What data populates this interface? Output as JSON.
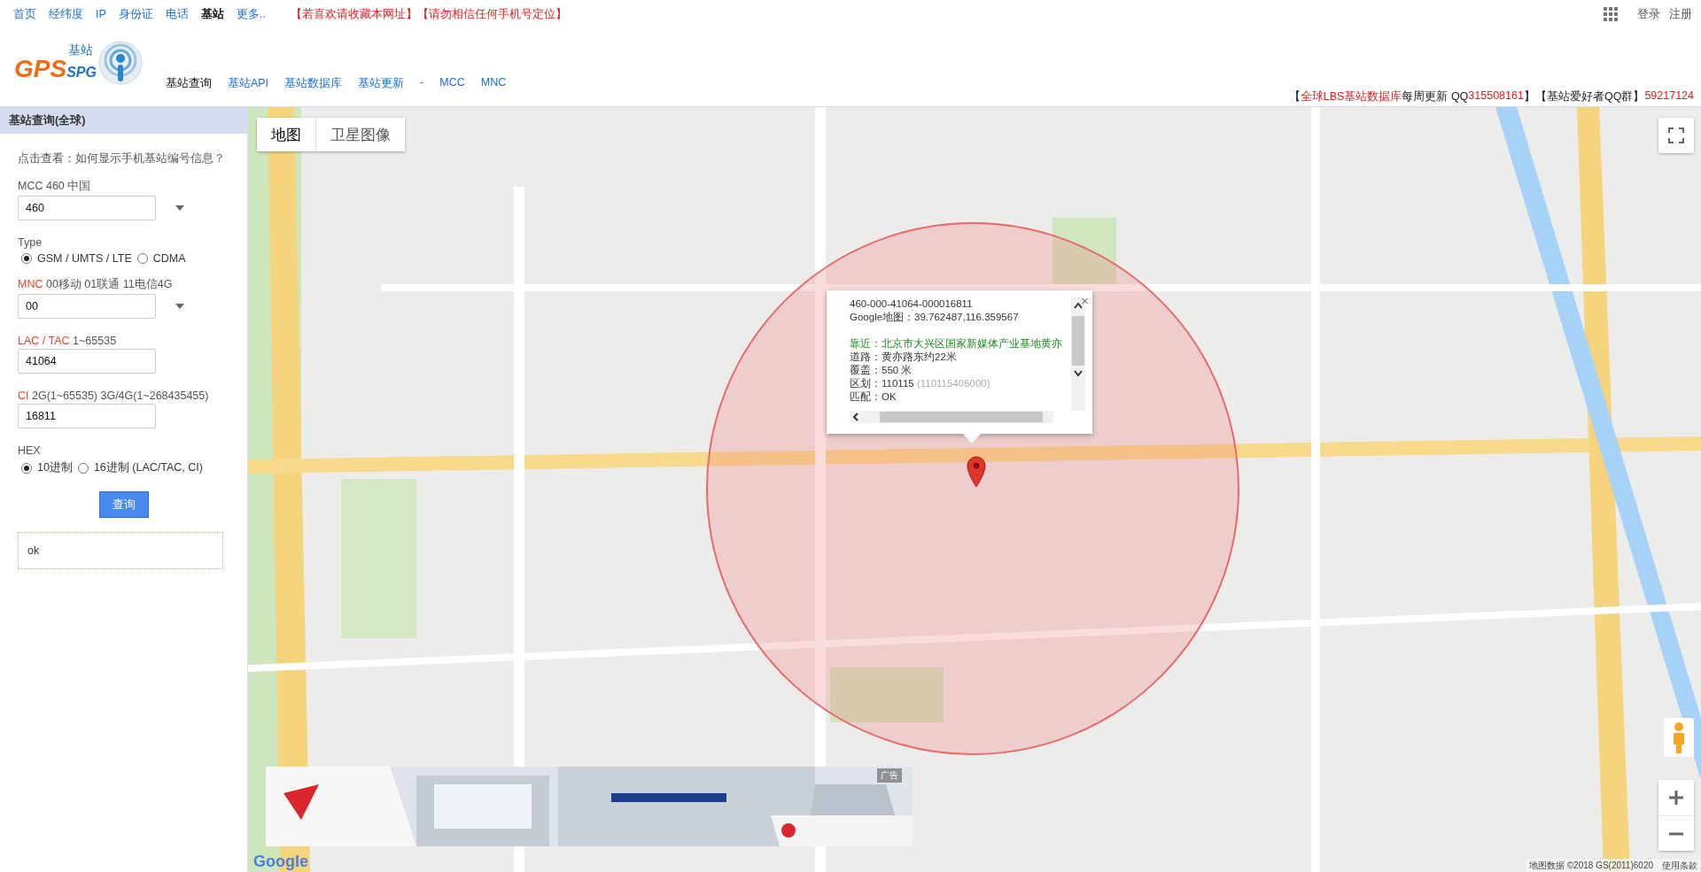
{
  "top_nav": {
    "links": [
      {
        "label": "首页",
        "selected": false
      },
      {
        "label": "经纬度",
        "selected": false
      },
      {
        "label": "IP",
        "selected": false
      },
      {
        "label": "身份证",
        "selected": false
      },
      {
        "label": "电话",
        "selected": false
      },
      {
        "label": "基站",
        "selected": true
      },
      {
        "label": "更多..",
        "selected": false
      }
    ],
    "notices": [
      "【若喜欢请收藏本网址】",
      "【请勿相信任何手机号定位】"
    ],
    "account": [
      "登录",
      "注册"
    ]
  },
  "header": {
    "logo": {
      "main": "GPS",
      "sub": "SPG",
      "tag": "基站"
    },
    "subnav": [
      {
        "label": "基站查询",
        "selected": true
      },
      {
        "label": "基站API",
        "selected": false
      },
      {
        "label": "基站数据库",
        "selected": false
      },
      {
        "label": "基站更新",
        "selected": false
      },
      {
        "label": "-",
        "selected": false
      },
      {
        "label": "MCC",
        "selected": false
      },
      {
        "label": "MNC",
        "selected": false
      }
    ],
    "promo": [
      {
        "text": "【",
        "highlight": false
      },
      {
        "text": "全球LBS基站数据库",
        "highlight": true
      },
      {
        "text": "每周更新 QQ",
        "highlight": false
      },
      {
        "text": "315508161",
        "highlight": true
      },
      {
        "text": "】【基站爱好者QQ群】",
        "highlight": false
      },
      {
        "text": "59217124",
        "highlight": true
      }
    ]
  },
  "panel": {
    "title": "基站查询(全球)",
    "help": "点击查看：如何显示手机基站编号信息？",
    "fields": [
      {
        "kind": "select",
        "label": "MCC 460 中国",
        "value": "460"
      },
      {
        "kind": "radio",
        "label": "Type",
        "options": [
          {
            "label": "GSM / UMTS / LTE",
            "selected": true
          },
          {
            "label": "CDMA",
            "selected": false
          }
        ]
      },
      {
        "kind": "select",
        "key": "MNC",
        "label": "00移动 01联通 11电信4G",
        "value": "00"
      },
      {
        "kind": "input",
        "key": "LAC / TAC",
        "label": "1~65535",
        "value": "41064"
      },
      {
        "kind": "input",
        "key": "CI",
        "label": "2G(1~65535) 3G/4G(1~268435455)",
        "value": "16811"
      },
      {
        "kind": "radio",
        "label": "HEX",
        "options": [
          {
            "label": "10进制",
            "selected": true
          },
          {
            "label": "16进制 (LAC/TAC, CI)",
            "selected": false
          }
        ]
      }
    ],
    "button": "查询",
    "result": "ok"
  },
  "map": {
    "map_types": [
      {
        "label": "地图",
        "selected": true
      },
      {
        "label": "卫星图像",
        "selected": false
      }
    ],
    "info_window": {
      "lines": [
        {
          "kind": "plain",
          "text": "460-000-41064-000016811"
        },
        {
          "kind": "plain",
          "text": "Google地图：39.762487,116.359567"
        },
        {
          "kind": "gap"
        },
        {
          "kind": "nearby",
          "text": "靠近：北京市大兴区国家新媒体产业基地黄亦"
        },
        {
          "kind": "plain",
          "text": "道路：黄亦路东约22米"
        },
        {
          "kind": "plain",
          "text": "覆盖：550 米"
        },
        {
          "kind": "plain",
          "text": "区划：110115",
          "note": "(110115405000)"
        },
        {
          "kind": "plain",
          "text": "匹配：OK"
        }
      ],
      "close": "×"
    },
    "ad_badge": "广告",
    "logo": "Google",
    "attribution": "地图数据 ©2018 GS(2011)6020",
    "terms": "使用条款"
  }
}
